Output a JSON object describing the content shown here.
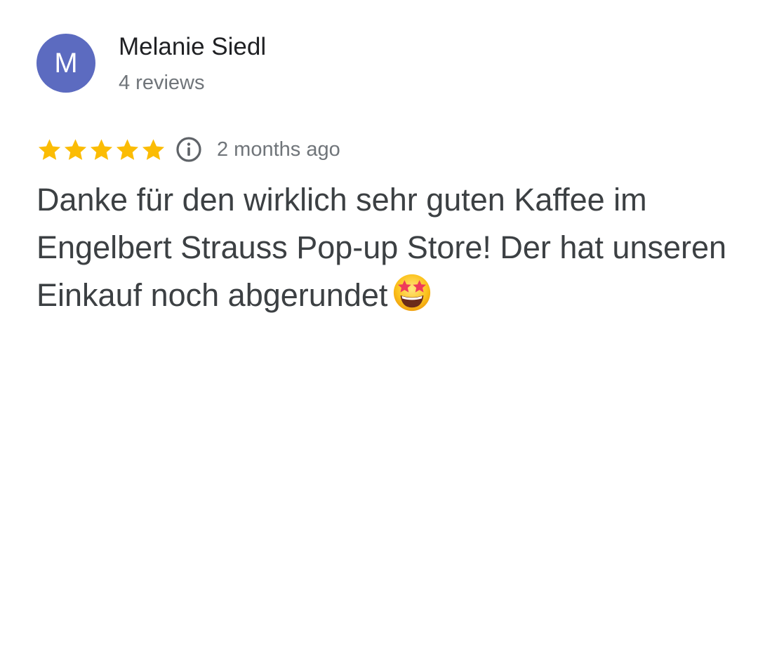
{
  "review": {
    "author": {
      "initial": "M",
      "name": "Melanie Siedl",
      "meta": "4 reviews",
      "avatar_color": "#5c6bc0"
    },
    "rating": {
      "stars": 5,
      "max_stars": 5,
      "star_color": "#fbbc04",
      "info_icon": "info-icon"
    },
    "time": "2 months ago",
    "text": "Danke für den wirklich sehr guten Kaffee im Engelbert Strauss Pop-up Store! Der hat unseren Einkauf noch abgerundet",
    "emoji": "star-struck-emoji"
  }
}
